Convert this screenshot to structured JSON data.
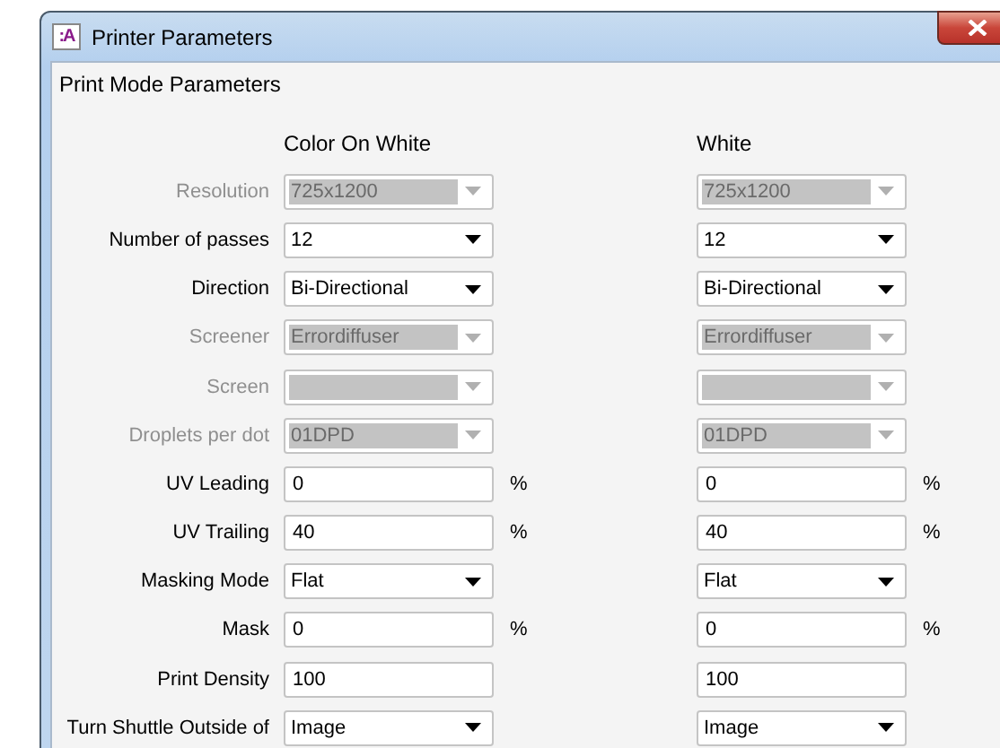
{
  "window": {
    "title": "Printer Parameters",
    "app_icon": ":A"
  },
  "panel": {
    "title": "Print Mode Parameters",
    "columns": [
      "Color On White",
      "White"
    ],
    "rows": [
      {
        "label": "Resolution",
        "kind": "select",
        "disabled": true,
        "cells": [
          {
            "value": "725x1200"
          },
          {
            "value": "725x1200"
          }
        ]
      },
      {
        "label": "Number of passes",
        "kind": "select",
        "disabled": false,
        "cells": [
          {
            "value": "12"
          },
          {
            "value": "12"
          }
        ]
      },
      {
        "label": "Direction",
        "kind": "select",
        "disabled": false,
        "cells": [
          {
            "value": "Bi-Directional"
          },
          {
            "value": "Bi-Directional"
          }
        ]
      },
      {
        "label": "Screener",
        "kind": "select",
        "disabled": true,
        "cells": [
          {
            "value": "Errordiffuser"
          },
          {
            "value": "Errordiffuser"
          }
        ]
      },
      {
        "label": "Screen",
        "kind": "select",
        "disabled": true,
        "cells": [
          {},
          {}
        ]
      },
      {
        "label": "Droplets per dot",
        "kind": "select",
        "disabled": true,
        "cells": [
          {
            "value": "01DPD"
          },
          {
            "value": "01DPD"
          }
        ]
      },
      {
        "label": "UV Leading",
        "kind": "input",
        "disabled": false,
        "cells": [
          {
            "value": "0",
            "unit": "%"
          },
          {
            "value": "0",
            "unit": "%"
          }
        ]
      },
      {
        "label": "UV Trailing",
        "kind": "input",
        "disabled": false,
        "cells": [
          {
            "value": "40",
            "unit": "%"
          },
          {
            "value": "40",
            "unit": "%"
          }
        ]
      },
      {
        "label": "Masking Mode",
        "kind": "select",
        "disabled": false,
        "cells": [
          {
            "value": "Flat"
          },
          {
            "value": "Flat"
          }
        ]
      },
      {
        "label": "Mask",
        "kind": "input",
        "disabled": false,
        "cells": [
          {
            "value": "0",
            "unit": "%"
          },
          {
            "value": "0",
            "unit": "%"
          }
        ]
      },
      {
        "label": "Print Density",
        "kind": "input",
        "disabled": false,
        "cells": [
          {
            "value": "100"
          },
          {
            "value": "100"
          }
        ]
      },
      {
        "label": "Turn Shuttle Outside of",
        "kind": "select",
        "disabled": false,
        "cells": [
          {
            "value": "Image"
          },
          {
            "value": "Image"
          }
        ]
      }
    ]
  }
}
